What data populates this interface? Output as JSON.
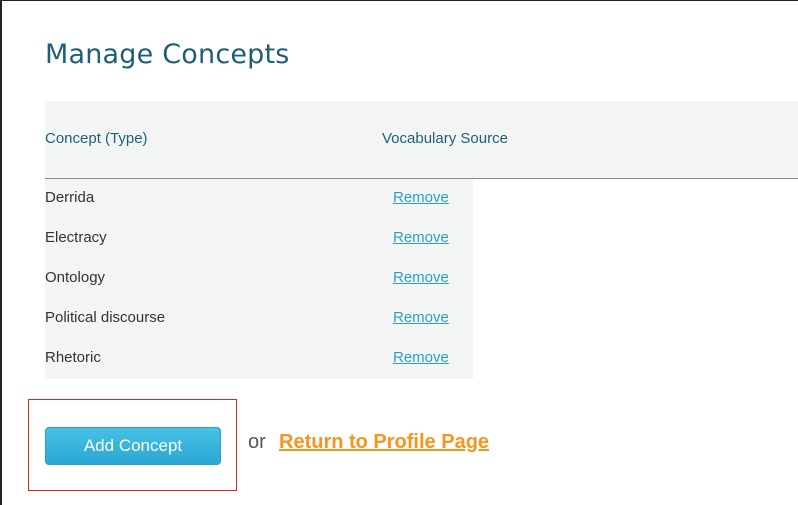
{
  "page": {
    "title": "Manage Concepts"
  },
  "table": {
    "headers": {
      "concept": "Concept (Type)",
      "source": "Vocabulary Source"
    },
    "rows": [
      {
        "concept": "Derrida",
        "action": "Remove"
      },
      {
        "concept": "Electracy",
        "action": "Remove"
      },
      {
        "concept": "Ontology",
        "action": "Remove"
      },
      {
        "concept": "Political discourse",
        "action": "Remove"
      },
      {
        "concept": "Rhetoric",
        "action": "Remove"
      }
    ]
  },
  "footer": {
    "add_button_label": "Add Concept",
    "or_text": "or",
    "return_link_label": "Return to Profile Page"
  },
  "colors": {
    "title": "#1f5f76",
    "link": "#2aa0c8",
    "button": "#2aa7d3",
    "return_link": "#f7941d",
    "highlight": "#d9262b"
  }
}
